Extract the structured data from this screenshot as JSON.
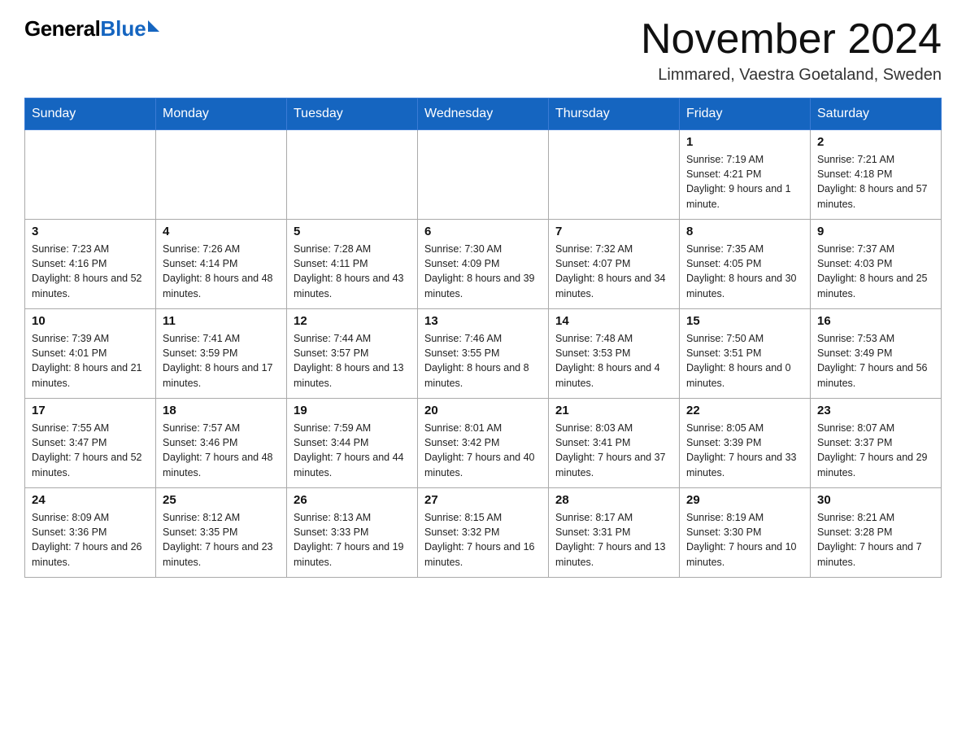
{
  "logo": {
    "general": "General",
    "blue": "Blue"
  },
  "title": "November 2024",
  "location": "Limmared, Vaestra Goetaland, Sweden",
  "days_of_week": [
    "Sunday",
    "Monday",
    "Tuesday",
    "Wednesday",
    "Thursday",
    "Friday",
    "Saturday"
  ],
  "weeks": [
    [
      {
        "day": "",
        "info": ""
      },
      {
        "day": "",
        "info": ""
      },
      {
        "day": "",
        "info": ""
      },
      {
        "day": "",
        "info": ""
      },
      {
        "day": "",
        "info": ""
      },
      {
        "day": "1",
        "info": "Sunrise: 7:19 AM\nSunset: 4:21 PM\nDaylight: 9 hours and 1 minute."
      },
      {
        "day": "2",
        "info": "Sunrise: 7:21 AM\nSunset: 4:18 PM\nDaylight: 8 hours and 57 minutes."
      }
    ],
    [
      {
        "day": "3",
        "info": "Sunrise: 7:23 AM\nSunset: 4:16 PM\nDaylight: 8 hours and 52 minutes."
      },
      {
        "day": "4",
        "info": "Sunrise: 7:26 AM\nSunset: 4:14 PM\nDaylight: 8 hours and 48 minutes."
      },
      {
        "day": "5",
        "info": "Sunrise: 7:28 AM\nSunset: 4:11 PM\nDaylight: 8 hours and 43 minutes."
      },
      {
        "day": "6",
        "info": "Sunrise: 7:30 AM\nSunset: 4:09 PM\nDaylight: 8 hours and 39 minutes."
      },
      {
        "day": "7",
        "info": "Sunrise: 7:32 AM\nSunset: 4:07 PM\nDaylight: 8 hours and 34 minutes."
      },
      {
        "day": "8",
        "info": "Sunrise: 7:35 AM\nSunset: 4:05 PM\nDaylight: 8 hours and 30 minutes."
      },
      {
        "day": "9",
        "info": "Sunrise: 7:37 AM\nSunset: 4:03 PM\nDaylight: 8 hours and 25 minutes."
      }
    ],
    [
      {
        "day": "10",
        "info": "Sunrise: 7:39 AM\nSunset: 4:01 PM\nDaylight: 8 hours and 21 minutes."
      },
      {
        "day": "11",
        "info": "Sunrise: 7:41 AM\nSunset: 3:59 PM\nDaylight: 8 hours and 17 minutes."
      },
      {
        "day": "12",
        "info": "Sunrise: 7:44 AM\nSunset: 3:57 PM\nDaylight: 8 hours and 13 minutes."
      },
      {
        "day": "13",
        "info": "Sunrise: 7:46 AM\nSunset: 3:55 PM\nDaylight: 8 hours and 8 minutes."
      },
      {
        "day": "14",
        "info": "Sunrise: 7:48 AM\nSunset: 3:53 PM\nDaylight: 8 hours and 4 minutes."
      },
      {
        "day": "15",
        "info": "Sunrise: 7:50 AM\nSunset: 3:51 PM\nDaylight: 8 hours and 0 minutes."
      },
      {
        "day": "16",
        "info": "Sunrise: 7:53 AM\nSunset: 3:49 PM\nDaylight: 7 hours and 56 minutes."
      }
    ],
    [
      {
        "day": "17",
        "info": "Sunrise: 7:55 AM\nSunset: 3:47 PM\nDaylight: 7 hours and 52 minutes."
      },
      {
        "day": "18",
        "info": "Sunrise: 7:57 AM\nSunset: 3:46 PM\nDaylight: 7 hours and 48 minutes."
      },
      {
        "day": "19",
        "info": "Sunrise: 7:59 AM\nSunset: 3:44 PM\nDaylight: 7 hours and 44 minutes."
      },
      {
        "day": "20",
        "info": "Sunrise: 8:01 AM\nSunset: 3:42 PM\nDaylight: 7 hours and 40 minutes."
      },
      {
        "day": "21",
        "info": "Sunrise: 8:03 AM\nSunset: 3:41 PM\nDaylight: 7 hours and 37 minutes."
      },
      {
        "day": "22",
        "info": "Sunrise: 8:05 AM\nSunset: 3:39 PM\nDaylight: 7 hours and 33 minutes."
      },
      {
        "day": "23",
        "info": "Sunrise: 8:07 AM\nSunset: 3:37 PM\nDaylight: 7 hours and 29 minutes."
      }
    ],
    [
      {
        "day": "24",
        "info": "Sunrise: 8:09 AM\nSunset: 3:36 PM\nDaylight: 7 hours and 26 minutes."
      },
      {
        "day": "25",
        "info": "Sunrise: 8:12 AM\nSunset: 3:35 PM\nDaylight: 7 hours and 23 minutes."
      },
      {
        "day": "26",
        "info": "Sunrise: 8:13 AM\nSunset: 3:33 PM\nDaylight: 7 hours and 19 minutes."
      },
      {
        "day": "27",
        "info": "Sunrise: 8:15 AM\nSunset: 3:32 PM\nDaylight: 7 hours and 16 minutes."
      },
      {
        "day": "28",
        "info": "Sunrise: 8:17 AM\nSunset: 3:31 PM\nDaylight: 7 hours and 13 minutes."
      },
      {
        "day": "29",
        "info": "Sunrise: 8:19 AM\nSunset: 3:30 PM\nDaylight: 7 hours and 10 minutes."
      },
      {
        "day": "30",
        "info": "Sunrise: 8:21 AM\nSunset: 3:28 PM\nDaylight: 7 hours and 7 minutes."
      }
    ]
  ]
}
